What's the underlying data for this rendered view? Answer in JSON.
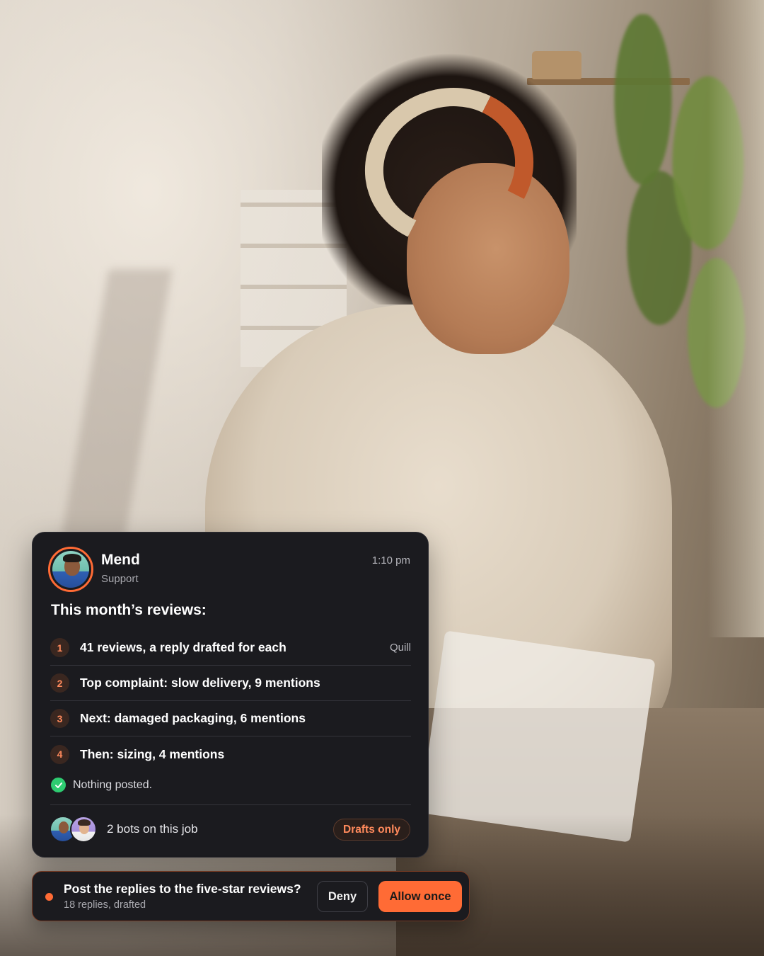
{
  "card": {
    "sender_name": "Mend",
    "sender_role": "Support",
    "time": "1:10 pm",
    "title": "This month’s reviews:",
    "items": [
      {
        "num": "1",
        "text": "41 reviews, a reply drafted for each",
        "tag": "Quill"
      },
      {
        "num": "2",
        "text": "Top complaint: slow delivery, 9 mentions",
        "tag": ""
      },
      {
        "num": "3",
        "text": "Next: damaged packaging, 6 mentions",
        "tag": ""
      },
      {
        "num": "4",
        "text": "Then: sizing, 4 mentions",
        "tag": ""
      }
    ],
    "status": "Nothing posted.",
    "footer_text": "2 bots on this job",
    "chip": "Drafts only"
  },
  "approval": {
    "question": "Post the replies to the five-star reviews?",
    "subtext": "18 replies, drafted",
    "deny_label": "Deny",
    "allow_label": "Allow once"
  },
  "colors": {
    "accent": "#ff6b35",
    "card_bg": "#1b1b1f",
    "success": "#2ecc71"
  },
  "icons": {
    "status": "check-circle-icon",
    "pending": "dot-indicator-icon"
  }
}
